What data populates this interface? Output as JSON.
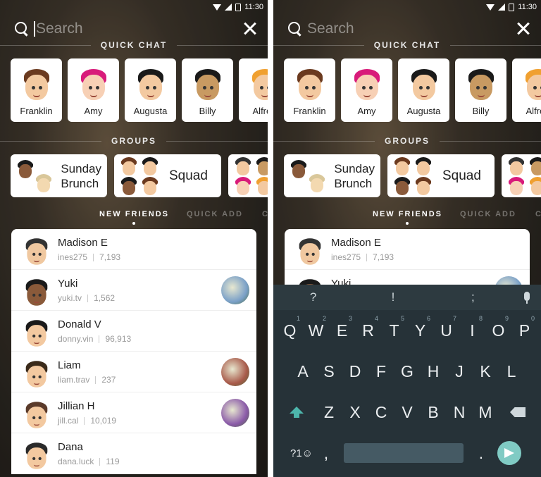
{
  "status": {
    "time": "11:30"
  },
  "search": {
    "placeholder": "Search"
  },
  "sections": {
    "quick_chat": "QUICK CHAT",
    "groups": "GROUPS"
  },
  "quick_chat": [
    {
      "name": "Franklin",
      "skin": "#f3c9a0",
      "hair": "#6b3a1f"
    },
    {
      "name": "Amy",
      "skin": "#f7d0b5",
      "hair": "#d81b7a"
    },
    {
      "name": "Augusta",
      "skin": "#f3c9a0",
      "hair": "#1a1a1a"
    },
    {
      "name": "Billy",
      "skin": "#c89a62",
      "hair": "#1a1a1a"
    },
    {
      "name": "Alfred",
      "skin": "#f3c9a0",
      "hair": "#f0a030"
    }
  ],
  "groups": [
    {
      "name_line1": "Sunday",
      "name_line2": "Brunch"
    },
    {
      "name": "Squad"
    }
  ],
  "tabs": {
    "new_friends": "NEW FRIENDS",
    "quick_add": "QUICK ADD",
    "more": "C"
  },
  "friends": [
    {
      "name": "Madison E",
      "username": "ines275",
      "score": "7,193",
      "skin": "#f0c8a0",
      "hair": "#333333"
    },
    {
      "name": "Yuki",
      "username": "yuki.tv",
      "score": "1,562",
      "skin": "#8a5a3a",
      "hair": "#1a1a1a",
      "thumb": "#7aa0c8"
    },
    {
      "name": "Donald V",
      "username": "donny.vin",
      "score": "96,913",
      "skin": "#f3c9a0",
      "hair": "#1a1a1a"
    },
    {
      "name": "Liam",
      "username": "liam.trav",
      "score": "237",
      "skin": "#f3c9a0",
      "hair": "#3a2a1a",
      "thumb": "#a85a4a"
    },
    {
      "name": "Jillian H",
      "username": "jill.cal",
      "score": "10,019",
      "skin": "#f3c9a0",
      "hair": "#5a3a2a",
      "thumb": "#8a5aa8"
    },
    {
      "name": "Dana",
      "username": "dana.luck",
      "score": "119",
      "skin": "#f3c9a0",
      "hair": "#2a2a2a"
    }
  ],
  "keyboard": {
    "suggestions": [
      "?",
      "!",
      ";"
    ],
    "row1": [
      [
        "Q",
        "1"
      ],
      [
        "W",
        "2"
      ],
      [
        "E",
        "3"
      ],
      [
        "R",
        "4"
      ],
      [
        "T",
        "5"
      ],
      [
        "Y",
        "6"
      ],
      [
        "U",
        "7"
      ],
      [
        "I",
        "8"
      ],
      [
        "O",
        "9"
      ],
      [
        "P",
        "0"
      ]
    ],
    "row2": [
      "A",
      "S",
      "D",
      "F",
      "G",
      "H",
      "J",
      "K",
      "L"
    ],
    "row3": [
      "Z",
      "X",
      "C",
      "V",
      "B",
      "N",
      "M"
    ],
    "symbols_key": "?1☺",
    "comma": ",",
    "period": "."
  }
}
